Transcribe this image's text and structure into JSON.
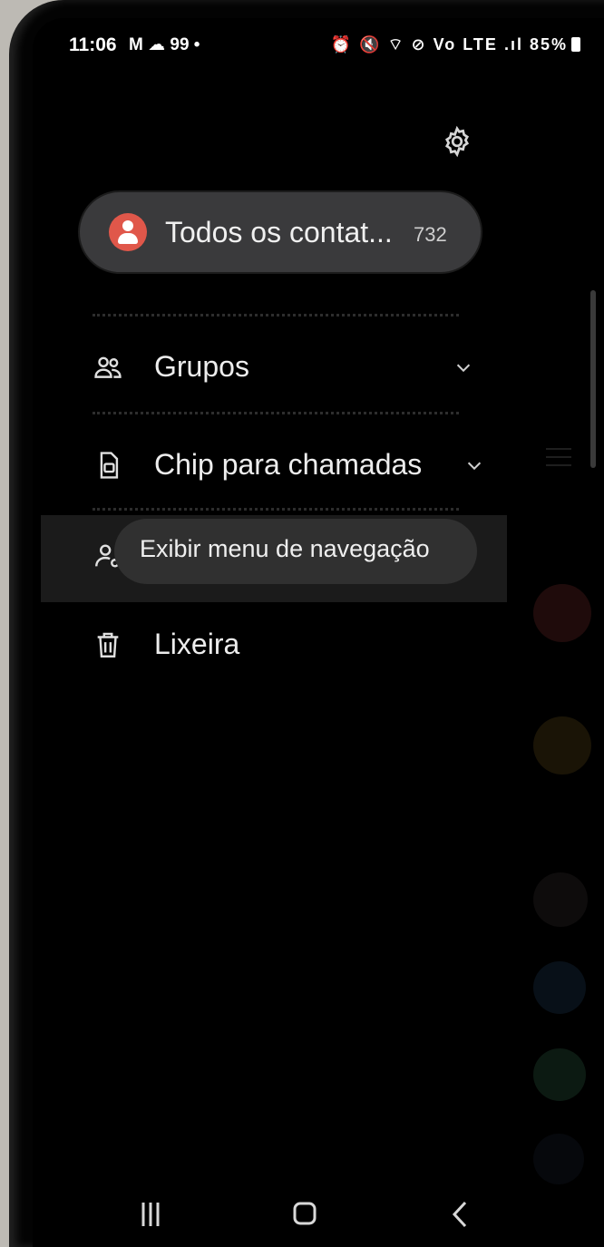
{
  "status_bar": {
    "time": "11:06",
    "left_icons": "M ☁ 99 •",
    "right_icons": "⏰ 🔇 ⌔ ⊘ Vo LTE .ıl",
    "battery": "85%"
  },
  "account_selector": {
    "label": "Todos os contat...",
    "count": "732",
    "avatar_color": "#e0574a"
  },
  "menu": {
    "groups_label": "Grupos",
    "sim_label": "Chip para chamadas",
    "trash_label": "Lixeira"
  },
  "tooltip": {
    "text": "Exibir menu de navegação"
  },
  "icons": {
    "settings": "gear-icon",
    "groups": "people-icon",
    "sim": "sim-card-icon",
    "manage": "person-settings-icon",
    "trash": "trash-icon",
    "recents": "recents-icon",
    "home": "home-icon",
    "back": "back-icon"
  }
}
